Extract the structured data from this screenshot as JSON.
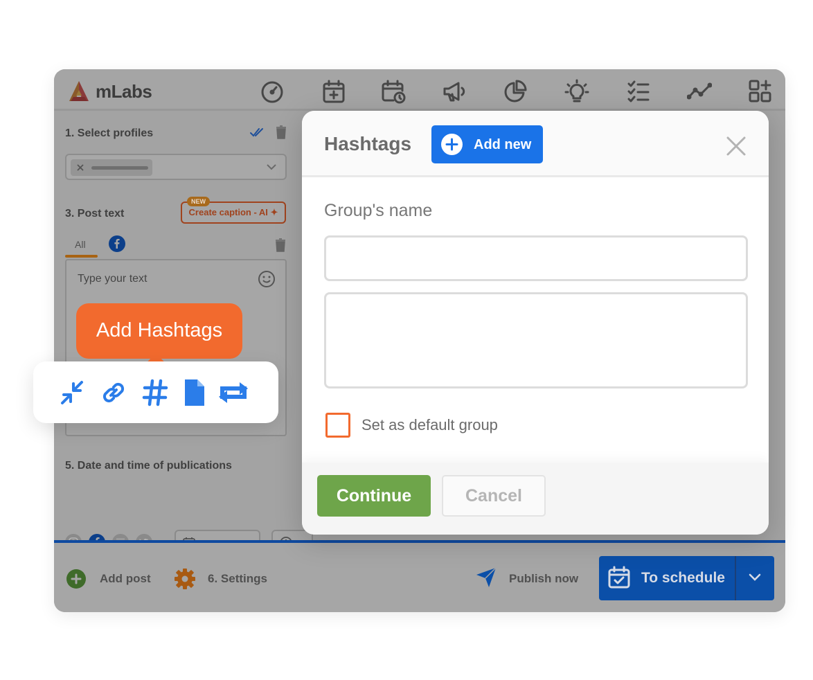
{
  "app": {
    "logo_text": "mLabs"
  },
  "nav": {
    "icons": [
      "dashboard-icon",
      "calendar-add-icon",
      "calendar-clock-icon",
      "megaphone-icon",
      "pie-chart-icon",
      "lightbulb-icon",
      "checklist-icon",
      "trend-line-icon",
      "apps-grid-icon"
    ]
  },
  "left": {
    "select_profiles_title": "1. Select profiles",
    "post_text_title": "3. Post text",
    "ai_button_label": "Create caption - AI ✦",
    "new_badge": "NEW",
    "tab_all": "All",
    "text_placeholder": "Type your text",
    "date_title": "5. Date and time of publications"
  },
  "bottom": {
    "add_post": "Add post",
    "settings": "6. Settings",
    "publish_now": "Publish now",
    "schedule": "To schedule"
  },
  "modal": {
    "title": "Hashtags",
    "add_new": "Add new",
    "group_name_label": "Group's name",
    "group_name_value": "",
    "hashtags_value": "",
    "default_label": "Set as default group",
    "continue": "Continue",
    "cancel": "Cancel"
  },
  "tooltip": {
    "text": "Add Hashtags"
  },
  "toolbar": {
    "icons": [
      "collapse-icon",
      "link-icon",
      "hashtag-icon",
      "document-icon",
      "repost-icon"
    ],
    "accent_color": "#2b7de9"
  },
  "colors": {
    "brand_orange": "#f26a2e",
    "primary_blue": "#1a73e8",
    "continue_green": "#6ea54a",
    "schedule_blue": "#0b4fa8"
  }
}
